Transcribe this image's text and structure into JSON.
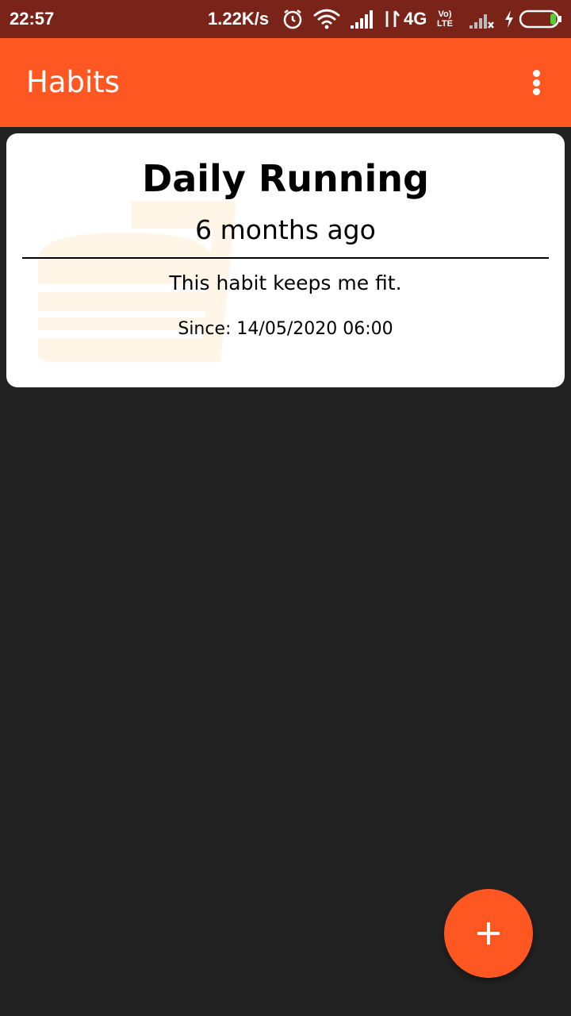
{
  "status_bar": {
    "time": "22:57",
    "net_speed": "1.22K/s",
    "network_type": "4G",
    "volte_top": "Vo)",
    "volte_bottom": "LTE",
    "icons": [
      "alarm-icon",
      "wifi-icon",
      "signal-icon",
      "data-arrows-icon",
      "no-signal-icon",
      "charging-icon",
      "battery-icon"
    ]
  },
  "app_bar": {
    "title": "Habits",
    "menu_icon": "more-vertical-icon"
  },
  "habits": [
    {
      "name": "Daily Running",
      "ago": "6 months ago",
      "description": "This habit keeps me fit.",
      "since": "Since: 14/05/2020 06:00"
    }
  ],
  "fab": {
    "icon": "plus-icon"
  },
  "colors": {
    "status_bar": "#7a2419",
    "accent": "#ff5722",
    "background": "#232323",
    "card": "#ffffff",
    "watermark": "#fff6e8"
  }
}
